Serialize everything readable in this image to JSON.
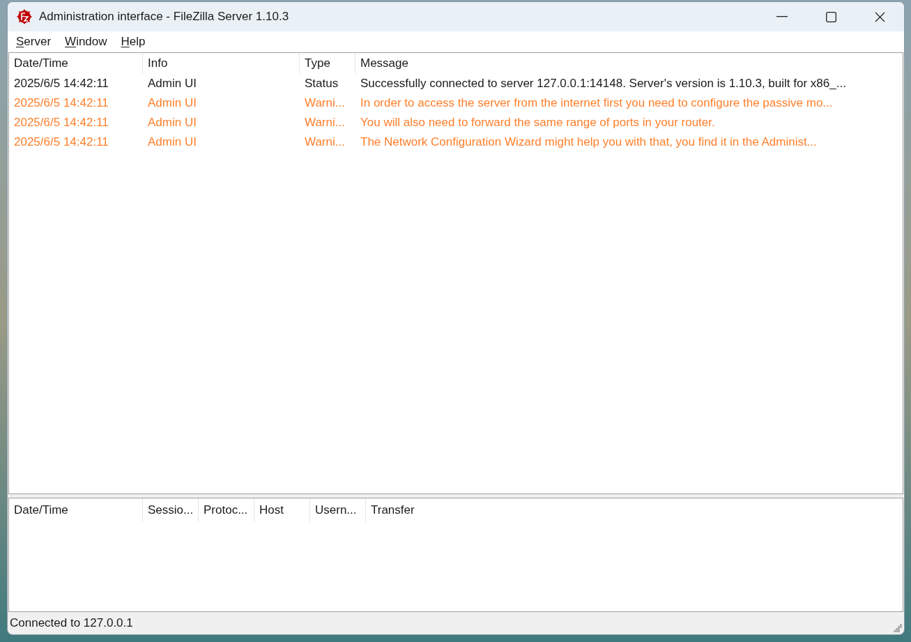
{
  "window": {
    "title": "Administration interface - FileZilla Server 1.10.3"
  },
  "menu": [
    "Server",
    "Window",
    "Help"
  ],
  "log": {
    "columns": [
      "Date/Time",
      "Info",
      "Type",
      "Message"
    ],
    "rows": [
      {
        "kind": "status",
        "date_time": "2025/6/5 14:42:11",
        "info": "Admin UI",
        "type": "Status",
        "message": "Successfully connected to server 127.0.0.1:14148. Server's version is 1.10.3, built for x86_..."
      },
      {
        "kind": "warning",
        "date_time": "2025/6/5 14:42:11",
        "info": "Admin UI",
        "type": "Warni...",
        "message": "In order to access the server from the internet first you need to configure the passive mo..."
      },
      {
        "kind": "warning",
        "date_time": "2025/6/5 14:42:11",
        "info": "Admin UI",
        "type": "Warni...",
        "message": "You will also need to forward the same range of ports in your router."
      },
      {
        "kind": "warning",
        "date_time": "2025/6/5 14:42:11",
        "info": "Admin UI",
        "type": "Warni...",
        "message": "The Network Configuration Wizard might help you with that, you find it in the Administ..."
      }
    ]
  },
  "sessions": {
    "columns": [
      "Date/Time",
      "Sessio...",
      "Protoc...",
      "Host",
      "Usern...",
      "Transfer"
    ]
  },
  "status_bar": "Connected to 127.0.0.1"
}
